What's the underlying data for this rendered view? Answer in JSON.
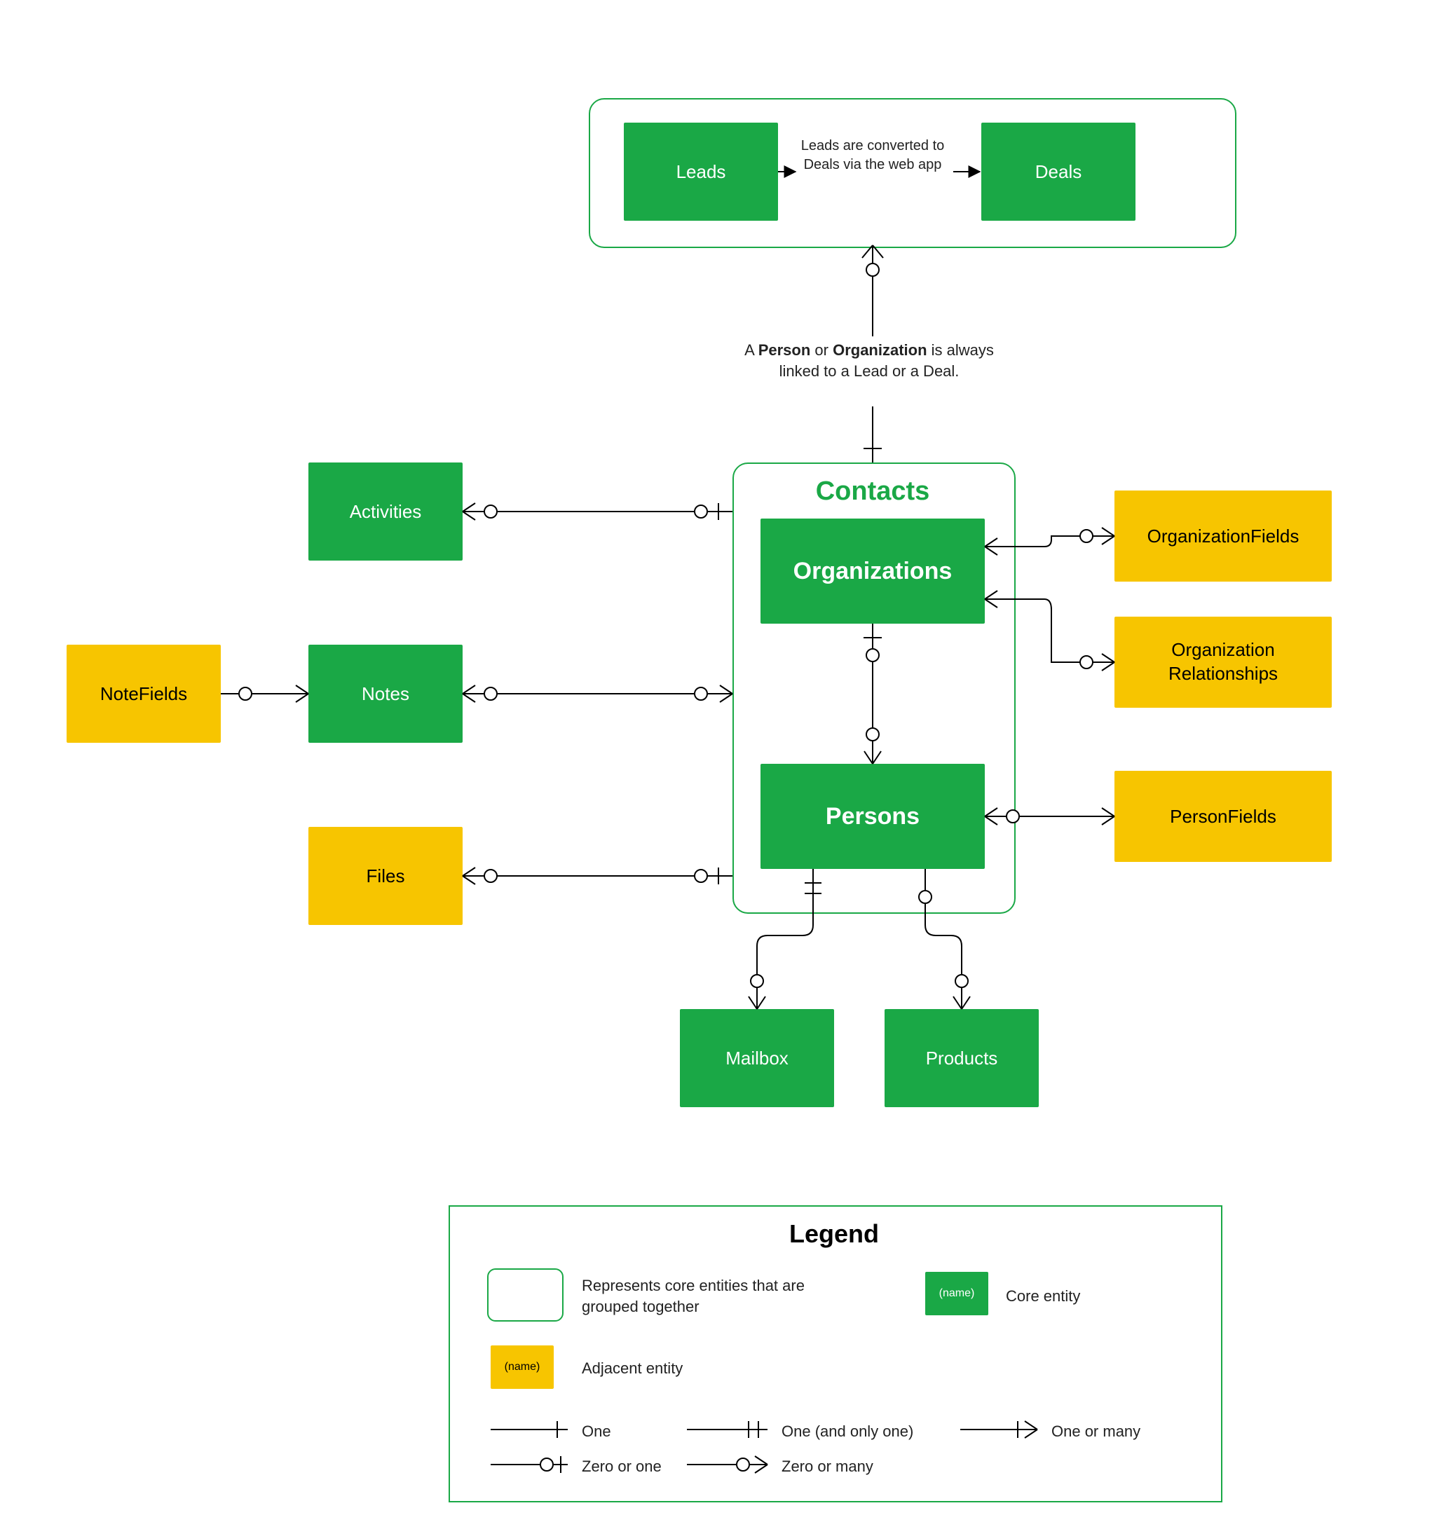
{
  "colors": {
    "core": "#1aa846",
    "adjacent": "#f7c500",
    "stroke": "#000"
  },
  "topGroup": {
    "leads": "Leads",
    "deals": "Deals",
    "middle": "Leads are converted to Deals via the web app"
  },
  "linkText": {
    "prefix": "A ",
    "b1": "Person",
    "mid": " or ",
    "b2": "Organization",
    "suffix": " is always linked to a Lead or a Deal."
  },
  "contacts": {
    "title": "Contacts",
    "organizations": "Organizations",
    "persons": "Persons"
  },
  "left": {
    "activities": "Activities",
    "notes": "Notes",
    "notefields": "NoteFields",
    "files": "Files"
  },
  "right": {
    "orgfields": "OrganizationFields",
    "orgrel": "Organization Relationships",
    "personfields": "PersonFields"
  },
  "bottom": {
    "mailbox": "Mailbox",
    "products": "Products"
  },
  "legend": {
    "title": "Legend",
    "grouped": "Represents core entities that are grouped together",
    "core": "Core entity",
    "coreSwatch": "(name)",
    "adjacent": "Adjacent entity",
    "adjSwatch": "(name)",
    "one": "One",
    "oneOnly": "One (and only one)",
    "oneOrMany": "One or many",
    "zeroOrOne": "Zero or one",
    "zeroOrMany": "Zero or many"
  }
}
